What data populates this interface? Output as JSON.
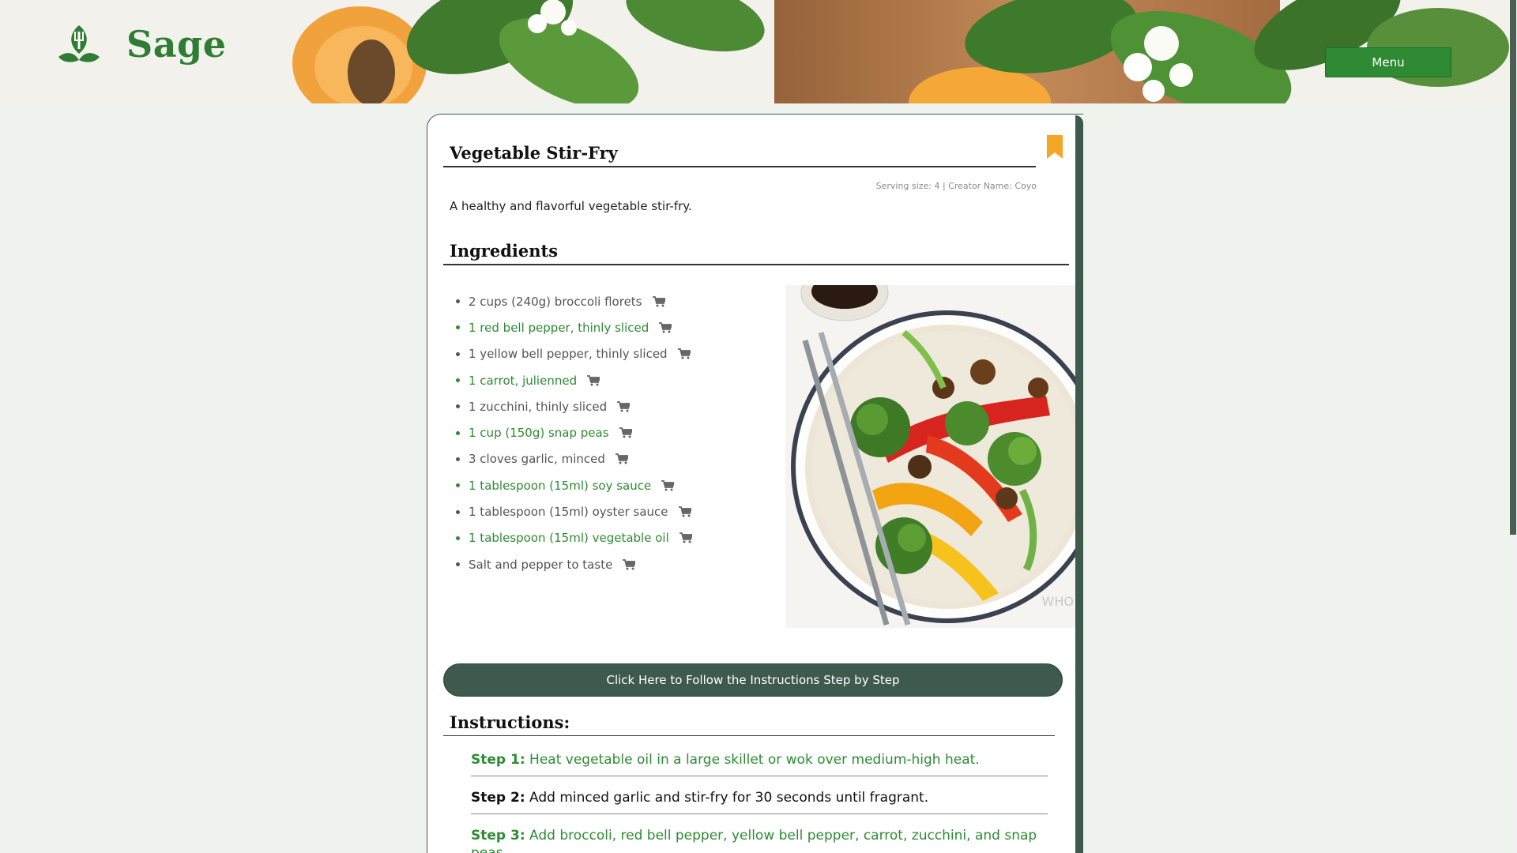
{
  "header": {
    "brand": "Sage",
    "menu_label": "Menu"
  },
  "recipe": {
    "title": "Vegetable Stir-Fry",
    "meta": "Serving size: 4 | Creator Name: Coyo",
    "description": "A healthy and flavorful vegetable stir-fry.",
    "ingredients_heading": "Ingredients",
    "ingredients": [
      "2 cups (240g) broccoli florets",
      "1 red bell pepper, thinly sliced",
      "1 yellow bell pepper, thinly sliced",
      "1 carrot, julienned",
      "1 zucchini, thinly sliced",
      "1 cup (150g) snap peas",
      "3 cloves garlic, minced",
      "1 tablespoon (15ml) soy sauce",
      "1 tablespoon (15ml) oyster sauce",
      "1 tablespoon (15ml) vegetable oil",
      "Salt and pepper to taste"
    ],
    "follow_button": "Click Here to Follow the Instructions Step by Step",
    "instructions_heading": "Instructions:",
    "steps": [
      {
        "label": "Step 1:",
        "text": "Heat vegetable oil in a large skillet or wok over medium-high heat."
      },
      {
        "label": "Step 2:",
        "text": "Add minced garlic and stir-fry for 30 seconds until fragrant."
      },
      {
        "label": "Step 3:",
        "text": "Add broccoli, red bell pepper, yellow bell pepper, carrot, zucchini, and snap peas"
      }
    ],
    "photo_watermark": "WHO"
  },
  "colors": {
    "brand_green": "#2e7d32",
    "accent_green": "#2e8b33",
    "card_rail": "#3e5a4c",
    "bookmark": "#f5a623"
  },
  "icons": {
    "logo": "leaf-fork-icon",
    "bookmark": "bookmark-icon",
    "cart": "cart-icon"
  }
}
